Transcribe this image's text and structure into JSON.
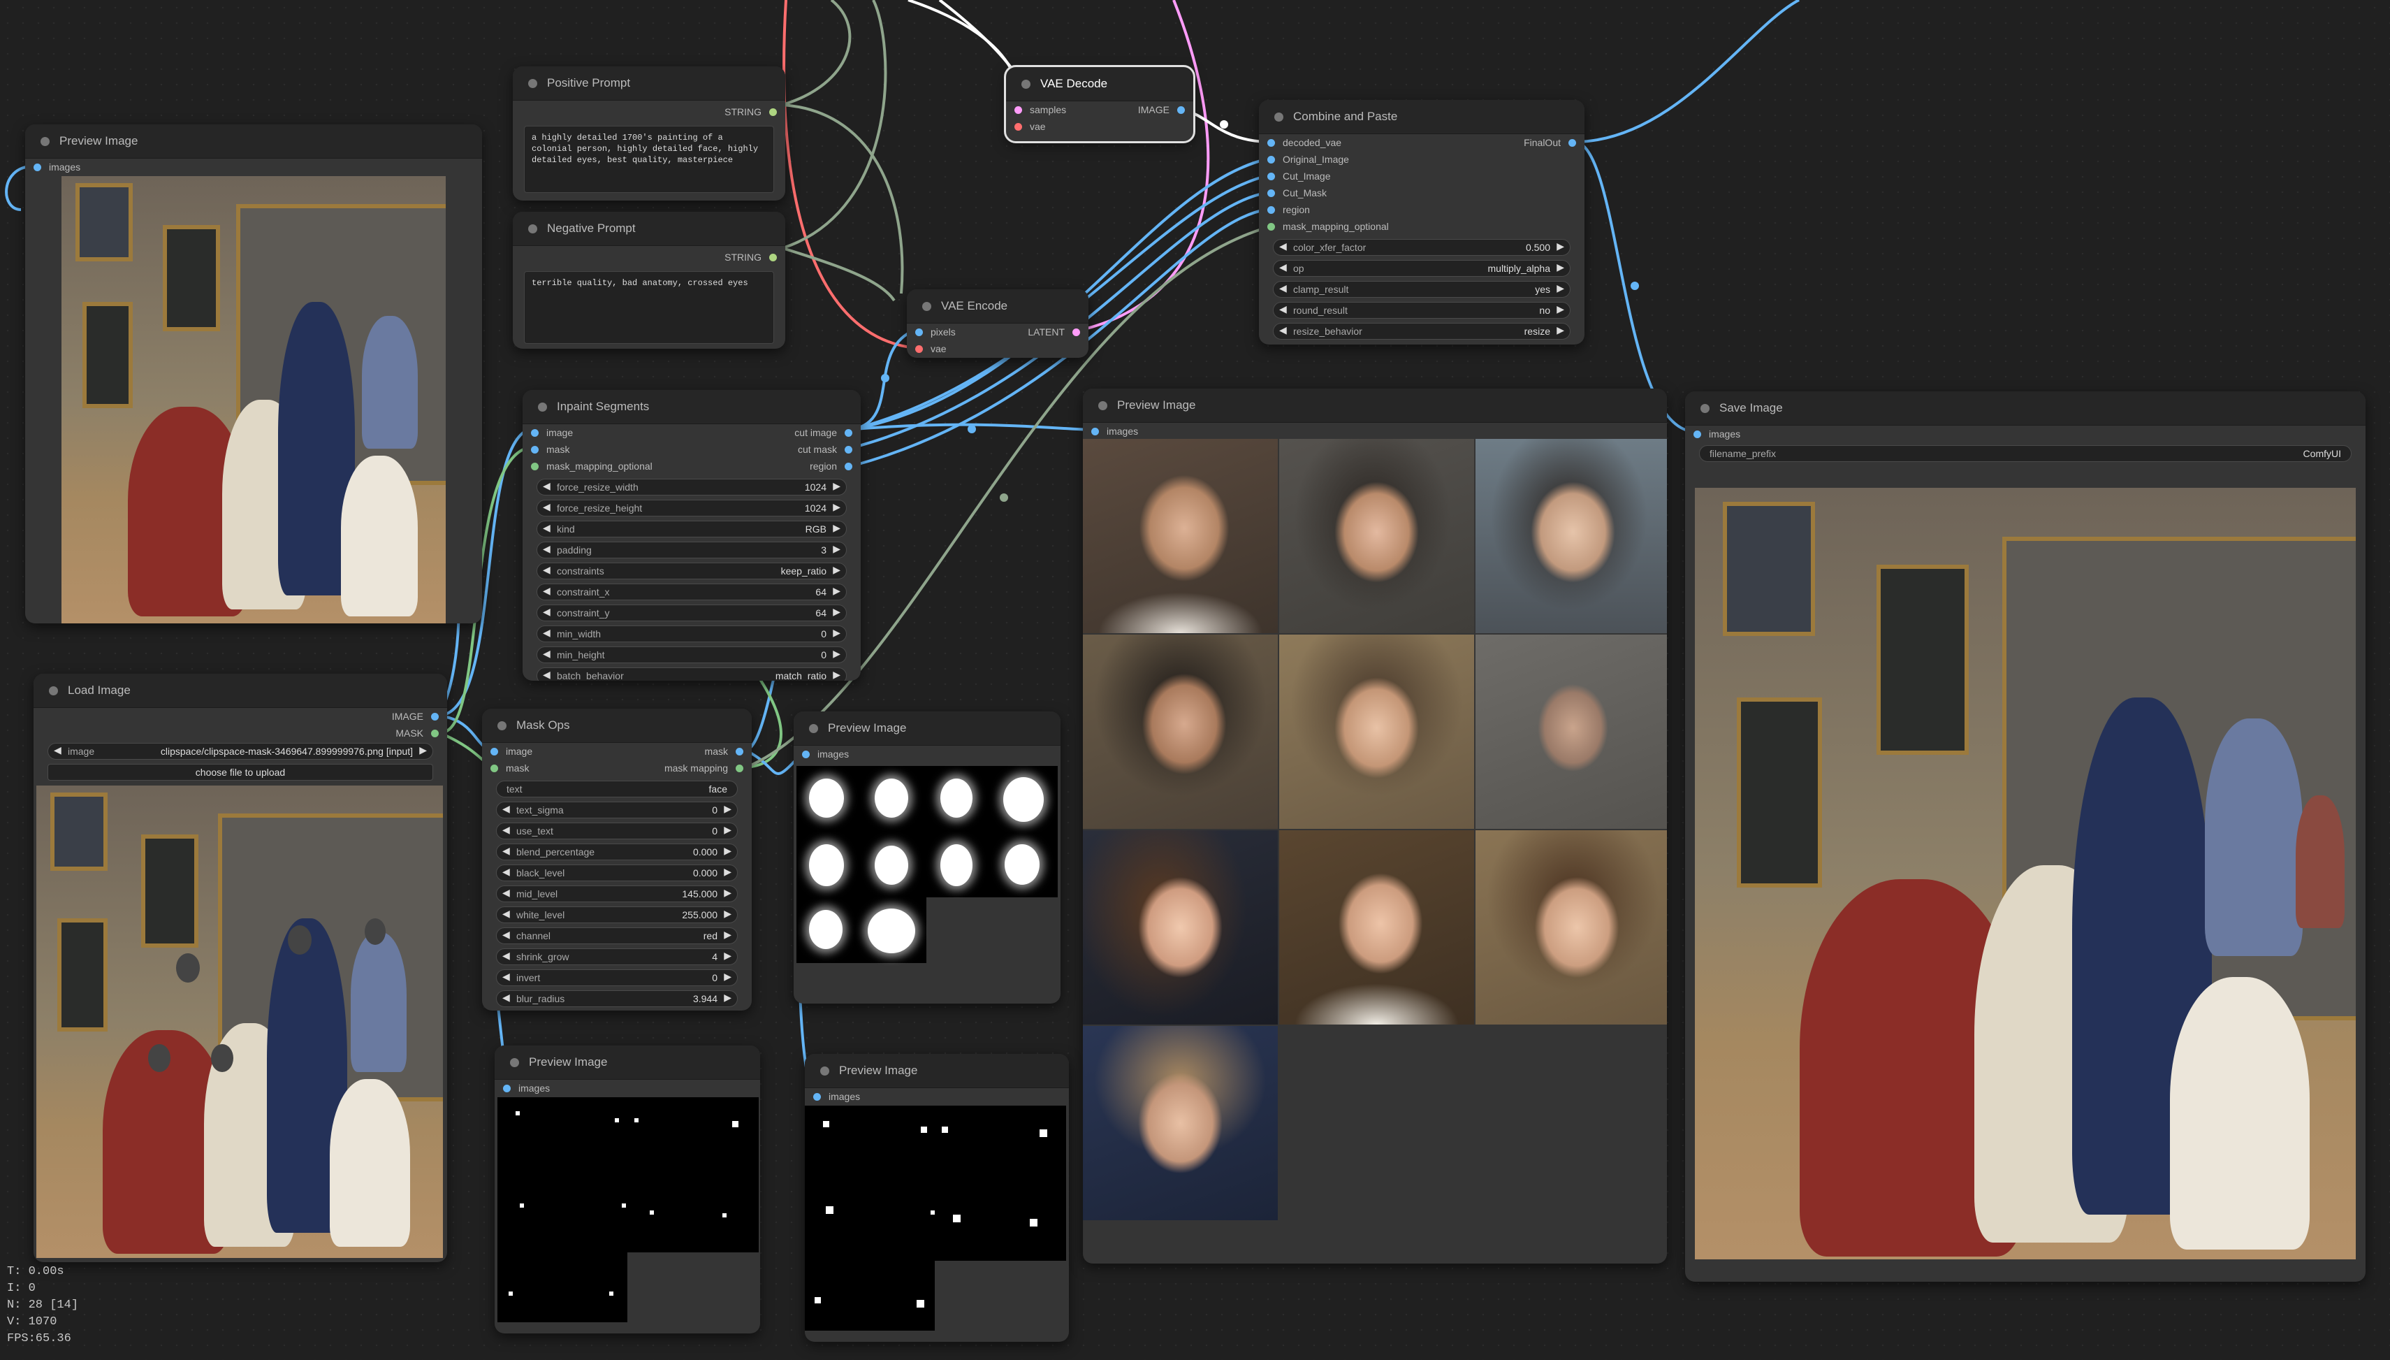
{
  "colors": {
    "background": "#202020",
    "node": "#353535",
    "image_link": "#64b5f6",
    "mask_link": "#81c784",
    "latent_link": "#ff9cf9",
    "vae_link": "#ff6e6e",
    "string_link": "#aed581"
  },
  "nodes": {
    "preview_top_left": {
      "title": "Preview Image",
      "input": "images"
    },
    "positive_prompt": {
      "title": "Positive Prompt",
      "output": "STRING",
      "text": "a highly detailed 1700's painting of a colonial person, highly detailed face, highly detailed eyes, best quality, masterpiece"
    },
    "negative_prompt": {
      "title": "Negative Prompt",
      "output": "STRING",
      "text": "terrible quality, bad anatomy, crossed eyes"
    },
    "vae_decode": {
      "title": "VAE Decode",
      "inputs": [
        "samples",
        "vae"
      ],
      "output": "IMAGE"
    },
    "vae_encode": {
      "title": "VAE Encode",
      "inputs": [
        "pixels",
        "vae"
      ],
      "output": "LATENT"
    },
    "combine_paste": {
      "title": "Combine and Paste",
      "inputs": [
        "decoded_vae",
        "Original_Image",
        "Cut_Image",
        "Cut_Mask",
        "region",
        "mask_mapping_optional"
      ],
      "output": "FinalOut",
      "widgets": [
        {
          "label": "color_xfer_factor",
          "value": "0.500"
        },
        {
          "label": "op",
          "value": "multiply_alpha"
        },
        {
          "label": "clamp_result",
          "value": "yes"
        },
        {
          "label": "round_result",
          "value": "no"
        },
        {
          "label": "resize_behavior",
          "value": "resize"
        }
      ]
    },
    "inpaint_segments": {
      "title": "Inpaint Segments",
      "inputs": [
        "image",
        "mask",
        "mask_mapping_optional"
      ],
      "outputs": [
        "cut image",
        "cut mask",
        "region"
      ],
      "widgets": [
        {
          "label": "force_resize_width",
          "value": "1024"
        },
        {
          "label": "force_resize_height",
          "value": "1024"
        },
        {
          "label": "kind",
          "value": "RGB"
        },
        {
          "label": "padding",
          "value": "3"
        },
        {
          "label": "constraints",
          "value": "keep_ratio"
        },
        {
          "label": "constraint_x",
          "value": "64"
        },
        {
          "label": "constraint_y",
          "value": "64"
        },
        {
          "label": "min_width",
          "value": "0"
        },
        {
          "label": "min_height",
          "value": "0"
        },
        {
          "label": "batch_behavior",
          "value": "match_ratio"
        }
      ]
    },
    "load_image": {
      "title": "Load Image",
      "outputs": [
        "IMAGE",
        "MASK"
      ],
      "image_label": "image",
      "image_value": "clipspace/clipspace-mask-3469647.899999976.png [input]",
      "upload_label": "choose file to upload"
    },
    "mask_ops": {
      "title": "Mask Ops",
      "inputs": [
        "image",
        "mask"
      ],
      "outputs": [
        "mask",
        "mask mapping"
      ],
      "text_widget": {
        "label": "text",
        "value": "face"
      },
      "widgets": [
        {
          "label": "text_sigma",
          "value": "0"
        },
        {
          "label": "use_text",
          "value": "0"
        },
        {
          "label": "blend_percentage",
          "value": "0.000"
        },
        {
          "label": "black_level",
          "value": "0.000"
        },
        {
          "label": "mid_level",
          "value": "145.000"
        },
        {
          "label": "white_level",
          "value": "255.000"
        },
        {
          "label": "channel",
          "value": "red"
        },
        {
          "label": "shrink_grow",
          "value": "4"
        },
        {
          "label": "invert",
          "value": "0"
        },
        {
          "label": "blur_radius",
          "value": "3.944"
        }
      ]
    },
    "preview_masks": {
      "title": "Preview Image",
      "input": "images"
    },
    "preview_faces": {
      "title": "Preview Image",
      "input": "images"
    },
    "save_image": {
      "title": "Save Image",
      "input": "images",
      "prefix_label": "filename_prefix",
      "prefix_value": "ComfyUI"
    },
    "preview_dots_a": {
      "title": "Preview Image",
      "input": "images"
    },
    "preview_dots_b": {
      "title": "Preview Image",
      "input": "images"
    }
  },
  "stats": {
    "t": "T: 0.00s",
    "i": "I: 0",
    "n": "N: 28 [14]",
    "v": "V: 1070",
    "fps": "FPS:65.36"
  }
}
